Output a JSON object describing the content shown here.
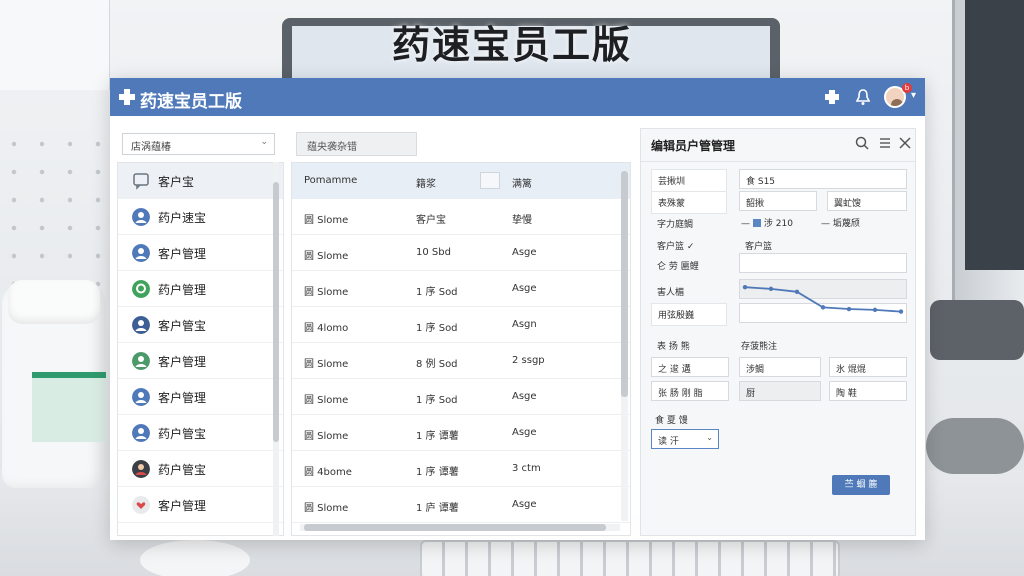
{
  "banner": {
    "title": "药速宝员工版"
  },
  "app": {
    "title": "药速宝员工版",
    "notification_badge": "b",
    "colors": {
      "accent": "#4f79b9",
      "header_row": "#e8eef6",
      "active_item": "#edf1f6"
    }
  },
  "toolbar": {
    "dropdown_value": "店涡蕴椿",
    "search_text": "蕴央袭杂错"
  },
  "sidebar": {
    "items": [
      {
        "label": "客户宝",
        "icon": "chat-icon"
      },
      {
        "label": "药户速宝",
        "icon": "user-icon"
      },
      {
        "label": "客户管理",
        "icon": "user-icon"
      },
      {
        "label": "药户管理",
        "icon": "chat-bubble-icon"
      },
      {
        "label": "客户管宝",
        "icon": "user-icon"
      },
      {
        "label": "客户管理",
        "icon": "user-icon"
      },
      {
        "label": "客户管理",
        "icon": "user-icon"
      },
      {
        "label": "药户管宝",
        "icon": "user-icon"
      },
      {
        "label": "药户管宝",
        "icon": "user-icon"
      },
      {
        "label": "客户管理",
        "icon": "heart-user-icon"
      }
    ]
  },
  "table": {
    "columns": [
      "Pomamme",
      "籍浆",
      "满篱"
    ],
    "rows": [
      [
        "圆 Slome",
        "客户宝",
        "挚慢"
      ],
      [
        "圆 Slome",
        "10 Sbd",
        "Asge"
      ],
      [
        "圆 Slome",
        "1 序 Sod",
        "Asge"
      ],
      [
        "圆 4lomo",
        "1 序 Sod",
        "Asgn"
      ],
      [
        "圆 Slome",
        "8 例 Sod",
        "2 ssgp"
      ],
      [
        "圆 Slome",
        "1 序 Sod",
        "Asge"
      ],
      [
        "圆 Slome",
        "1 序 谭薯",
        "Asge"
      ],
      [
        "圆 4bome",
        "1 序 谭薯",
        "3 ctm"
      ],
      [
        "圆 Slome",
        "1 庐 谭薯",
        "Asge"
      ]
    ]
  },
  "panel": {
    "title": "编辑员户管管理",
    "row1": {
      "label": "芸揪圳",
      "value": "食 S15"
    },
    "row2": {
      "label": "表殊蒙",
      "field_a": "韶揪",
      "field_b": "翼虻馊"
    },
    "row3": {
      "label": "字力庭鲷",
      "legend_a": "涉 210",
      "legend_b": "垢蔑颀"
    },
    "row4": {
      "label": "客户篮 ✓",
      "value": "客户篮"
    },
    "row5": {
      "label": "仑 劳 匾鲤"
    },
    "row6": {
      "label": "害人楣"
    },
    "row7": {
      "label": "用弦殷巍"
    },
    "section2": {
      "label_a": "表 扬 熊",
      "label_b": "存菠熊注"
    },
    "grid": [
      [
        "之 逡 遘",
        "涉鲷",
        "氷 焜焜"
      ],
      [
        "张 肠 刚 脂",
        "厨",
        "陶 鞋"
      ]
    ],
    "select": {
      "label": "食 夏 馒",
      "value": "读 汗"
    },
    "save_label": "苎 蛔 簏"
  },
  "chart_data": {
    "type": "line",
    "x": [
      1,
      2,
      3,
      4,
      5,
      6,
      7
    ],
    "series": [
      {
        "values": [
          9,
          8.6,
          7.9,
          4.2,
          3.8,
          3.6,
          3.2
        ]
      }
    ],
    "ylim": [
      0,
      10
    ],
    "grid": false
  }
}
